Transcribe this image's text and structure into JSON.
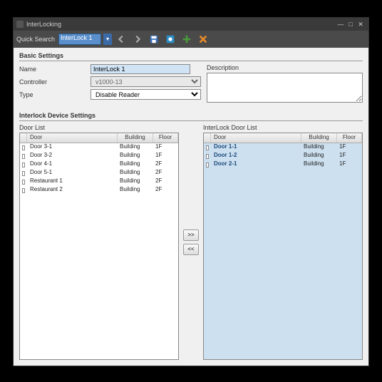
{
  "window": {
    "title": "InterLocking"
  },
  "toolbar": {
    "quick_search_label": "Quick Search",
    "quick_search_value": "InterLock 1"
  },
  "basic": {
    "section_title": "Basic Settings",
    "name_label": "Name",
    "name_value": "InterLock 1",
    "controller_label": "Controller",
    "controller_value": "v1000-13",
    "type_label": "Type",
    "type_value": "Disable Reader",
    "description_label": "Description",
    "description_value": ""
  },
  "device": {
    "section_title": "Interlock Device Settings",
    "left_title": "Door List",
    "right_title": "InterLock Door List",
    "headers": {
      "door": "Door",
      "building": "Building",
      "floor": "Floor"
    },
    "transfer_add": ">>",
    "transfer_remove": "<<",
    "left_rows": [
      {
        "door": "Door 3-1",
        "building": "Building",
        "floor": "1F"
      },
      {
        "door": "Door 3-2",
        "building": "Building",
        "floor": "1F"
      },
      {
        "door": "Door 4-1",
        "building": "Building",
        "floor": "2F"
      },
      {
        "door": "Door 5-1",
        "building": "Building",
        "floor": "2F"
      },
      {
        "door": "Restaurant 1",
        "building": "Building",
        "floor": "2F"
      },
      {
        "door": "Restaurant 2",
        "building": "Building",
        "floor": "2F"
      }
    ],
    "right_rows": [
      {
        "door": "Door 1-1",
        "building": "Building",
        "floor": "1F"
      },
      {
        "door": "Door 1-2",
        "building": "Building",
        "floor": "1F"
      },
      {
        "door": "Door 2-1",
        "building": "Building",
        "floor": "1F"
      }
    ]
  }
}
